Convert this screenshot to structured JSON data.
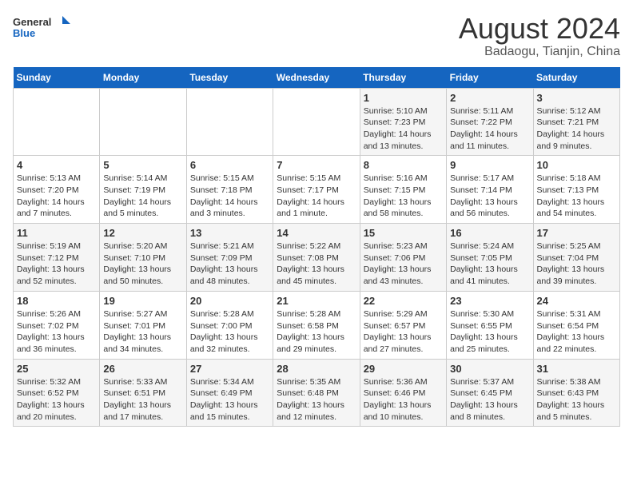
{
  "header": {
    "logo_general": "General",
    "logo_blue": "Blue",
    "title": "August 2024",
    "subtitle": "Badaogu, Tianjin, China"
  },
  "weekdays": [
    "Sunday",
    "Monday",
    "Tuesday",
    "Wednesday",
    "Thursday",
    "Friday",
    "Saturday"
  ],
  "weeks": [
    [
      {
        "day": "",
        "info": ""
      },
      {
        "day": "",
        "info": ""
      },
      {
        "day": "",
        "info": ""
      },
      {
        "day": "",
        "info": ""
      },
      {
        "day": "1",
        "info": "Sunrise: 5:10 AM\nSunset: 7:23 PM\nDaylight: 14 hours\nand 13 minutes."
      },
      {
        "day": "2",
        "info": "Sunrise: 5:11 AM\nSunset: 7:22 PM\nDaylight: 14 hours\nand 11 minutes."
      },
      {
        "day": "3",
        "info": "Sunrise: 5:12 AM\nSunset: 7:21 PM\nDaylight: 14 hours\nand 9 minutes."
      }
    ],
    [
      {
        "day": "4",
        "info": "Sunrise: 5:13 AM\nSunset: 7:20 PM\nDaylight: 14 hours\nand 7 minutes."
      },
      {
        "day": "5",
        "info": "Sunrise: 5:14 AM\nSunset: 7:19 PM\nDaylight: 14 hours\nand 5 minutes."
      },
      {
        "day": "6",
        "info": "Sunrise: 5:15 AM\nSunset: 7:18 PM\nDaylight: 14 hours\nand 3 minutes."
      },
      {
        "day": "7",
        "info": "Sunrise: 5:15 AM\nSunset: 7:17 PM\nDaylight: 14 hours\nand 1 minute."
      },
      {
        "day": "8",
        "info": "Sunrise: 5:16 AM\nSunset: 7:15 PM\nDaylight: 13 hours\nand 58 minutes."
      },
      {
        "day": "9",
        "info": "Sunrise: 5:17 AM\nSunset: 7:14 PM\nDaylight: 13 hours\nand 56 minutes."
      },
      {
        "day": "10",
        "info": "Sunrise: 5:18 AM\nSunset: 7:13 PM\nDaylight: 13 hours\nand 54 minutes."
      }
    ],
    [
      {
        "day": "11",
        "info": "Sunrise: 5:19 AM\nSunset: 7:12 PM\nDaylight: 13 hours\nand 52 minutes."
      },
      {
        "day": "12",
        "info": "Sunrise: 5:20 AM\nSunset: 7:10 PM\nDaylight: 13 hours\nand 50 minutes."
      },
      {
        "day": "13",
        "info": "Sunrise: 5:21 AM\nSunset: 7:09 PM\nDaylight: 13 hours\nand 48 minutes."
      },
      {
        "day": "14",
        "info": "Sunrise: 5:22 AM\nSunset: 7:08 PM\nDaylight: 13 hours\nand 45 minutes."
      },
      {
        "day": "15",
        "info": "Sunrise: 5:23 AM\nSunset: 7:06 PM\nDaylight: 13 hours\nand 43 minutes."
      },
      {
        "day": "16",
        "info": "Sunrise: 5:24 AM\nSunset: 7:05 PM\nDaylight: 13 hours\nand 41 minutes."
      },
      {
        "day": "17",
        "info": "Sunrise: 5:25 AM\nSunset: 7:04 PM\nDaylight: 13 hours\nand 39 minutes."
      }
    ],
    [
      {
        "day": "18",
        "info": "Sunrise: 5:26 AM\nSunset: 7:02 PM\nDaylight: 13 hours\nand 36 minutes."
      },
      {
        "day": "19",
        "info": "Sunrise: 5:27 AM\nSunset: 7:01 PM\nDaylight: 13 hours\nand 34 minutes."
      },
      {
        "day": "20",
        "info": "Sunrise: 5:28 AM\nSunset: 7:00 PM\nDaylight: 13 hours\nand 32 minutes."
      },
      {
        "day": "21",
        "info": "Sunrise: 5:28 AM\nSunset: 6:58 PM\nDaylight: 13 hours\nand 29 minutes."
      },
      {
        "day": "22",
        "info": "Sunrise: 5:29 AM\nSunset: 6:57 PM\nDaylight: 13 hours\nand 27 minutes."
      },
      {
        "day": "23",
        "info": "Sunrise: 5:30 AM\nSunset: 6:55 PM\nDaylight: 13 hours\nand 25 minutes."
      },
      {
        "day": "24",
        "info": "Sunrise: 5:31 AM\nSunset: 6:54 PM\nDaylight: 13 hours\nand 22 minutes."
      }
    ],
    [
      {
        "day": "25",
        "info": "Sunrise: 5:32 AM\nSunset: 6:52 PM\nDaylight: 13 hours\nand 20 minutes."
      },
      {
        "day": "26",
        "info": "Sunrise: 5:33 AM\nSunset: 6:51 PM\nDaylight: 13 hours\nand 17 minutes."
      },
      {
        "day": "27",
        "info": "Sunrise: 5:34 AM\nSunset: 6:49 PM\nDaylight: 13 hours\nand 15 minutes."
      },
      {
        "day": "28",
        "info": "Sunrise: 5:35 AM\nSunset: 6:48 PM\nDaylight: 13 hours\nand 12 minutes."
      },
      {
        "day": "29",
        "info": "Sunrise: 5:36 AM\nSunset: 6:46 PM\nDaylight: 13 hours\nand 10 minutes."
      },
      {
        "day": "30",
        "info": "Sunrise: 5:37 AM\nSunset: 6:45 PM\nDaylight: 13 hours\nand 8 minutes."
      },
      {
        "day": "31",
        "info": "Sunrise: 5:38 AM\nSunset: 6:43 PM\nDaylight: 13 hours\nand 5 minutes."
      }
    ]
  ]
}
